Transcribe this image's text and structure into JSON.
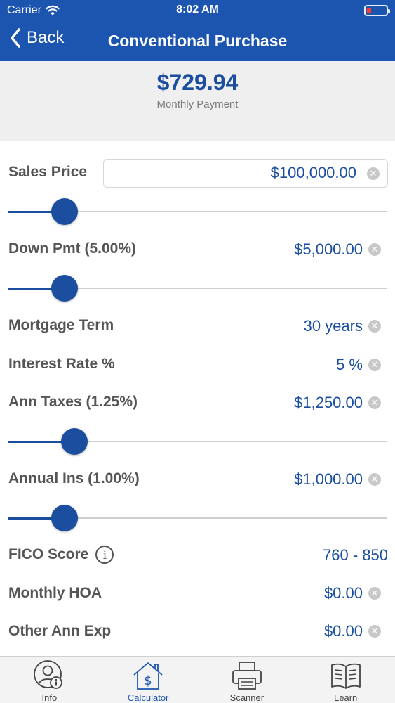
{
  "status_bar": {
    "carrier": "Carrier",
    "time": "8:02 AM"
  },
  "nav": {
    "back_label": "Back",
    "title": "Conventional Purchase"
  },
  "summary": {
    "amount": "$729.94",
    "label": "Monthly Payment"
  },
  "fields": {
    "sales_price": {
      "label": "Sales Price",
      "value": "$100,000.00"
    },
    "down_pmt": {
      "label": "Down Pmt (5.00%)",
      "value": "$5,000.00"
    },
    "mortgage_term": {
      "label": "Mortgage Term",
      "value": "30 years"
    },
    "interest_rate": {
      "label": "Interest Rate %",
      "value": "5 %"
    },
    "ann_taxes": {
      "label": "Ann Taxes (1.25%)",
      "value": "$1,250.00"
    },
    "annual_ins": {
      "label": "Annual Ins (1.00%)",
      "value": "$1,000.00"
    },
    "fico_score": {
      "label": "FICO Score",
      "value": "760 - 850",
      "info_glyph": "i"
    },
    "monthly_hoa": {
      "label": "Monthly HOA",
      "value": "$0.00"
    },
    "other_ann_exp": {
      "label": "Other Ann Exp",
      "value": "$0.00"
    }
  },
  "sliders": {
    "sales_price_fraction": 0.15,
    "down_pmt_fraction": 0.15,
    "ann_taxes_fraction": 0.175,
    "annual_ins_fraction": 0.15
  },
  "tabs": [
    {
      "label": "Info",
      "icon": "user-info-icon",
      "active": false
    },
    {
      "label": "Calculator",
      "icon": "house-dollar-icon",
      "active": true
    },
    {
      "label": "Scanner",
      "icon": "printer-icon",
      "active": false
    },
    {
      "label": "Learn",
      "icon": "book-icon",
      "active": false
    }
  ],
  "colors": {
    "brand": "#1b55b0",
    "accent": "#1b4e9f",
    "battery_low": "#ff3b30"
  }
}
